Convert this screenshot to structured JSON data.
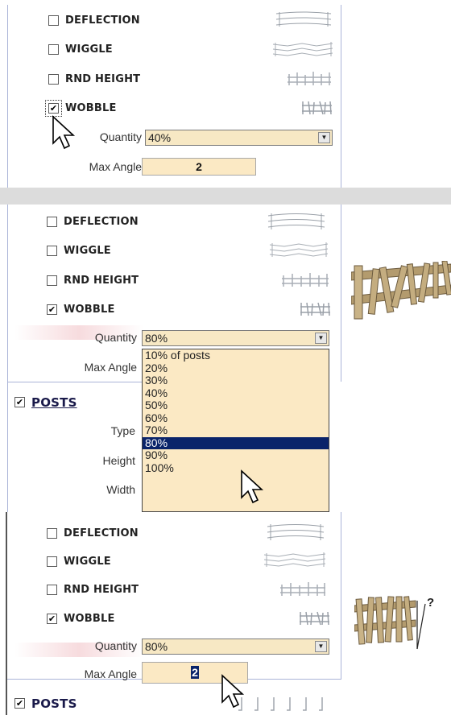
{
  "panel1": {
    "options": [
      {
        "label": "DEFLECTION",
        "checked": false,
        "icon": "deflection-thumb"
      },
      {
        "label": "WIGGLE",
        "checked": false,
        "icon": "wiggle-thumb"
      },
      {
        "label": "RND HEIGHT",
        "checked": false,
        "icon": "rnd-height-thumb"
      },
      {
        "label": "WOBBLE",
        "checked": true,
        "icon": "wobble-thumb"
      }
    ],
    "quantity_label": "Quantity",
    "quantity_value": "40%",
    "max_angle_label": "Max Angle",
    "max_angle_value": "2"
  },
  "panel2": {
    "options": [
      {
        "label": "DEFLECTION",
        "checked": false
      },
      {
        "label": "WIGGLE",
        "checked": false
      },
      {
        "label": "RND HEIGHT",
        "checked": false
      },
      {
        "label": "WOBBLE",
        "checked": true
      }
    ],
    "quantity_label": "Quantity",
    "quantity_value": "80%",
    "max_angle_label": "Max Angle",
    "posts_label": "POSTS",
    "type_label": "Type",
    "height_label": "Height",
    "width_label": "Width",
    "dropdown_options": [
      "10% of posts",
      "20%",
      "30%",
      "40%",
      "50%",
      "60%",
      "70%",
      "80%",
      "90%",
      "100%"
    ],
    "selected_option": "80%"
  },
  "panel3": {
    "options": [
      {
        "label": "DEFLECTION",
        "checked": false
      },
      {
        "label": "WIGGLE",
        "checked": false
      },
      {
        "label": "RND HEIGHT",
        "checked": false
      },
      {
        "label": "WOBBLE",
        "checked": true
      }
    ],
    "quantity_label": "Quantity",
    "quantity_value": "80%",
    "max_angle_label": "Max Angle",
    "max_angle_value": "2",
    "posts_label": "POSTS",
    "annotation": "?"
  },
  "check_glyph": "✔",
  "colors": {
    "field_bg": "#f7e8c4",
    "selection": "#0a246a",
    "border": "#aab4d8"
  }
}
